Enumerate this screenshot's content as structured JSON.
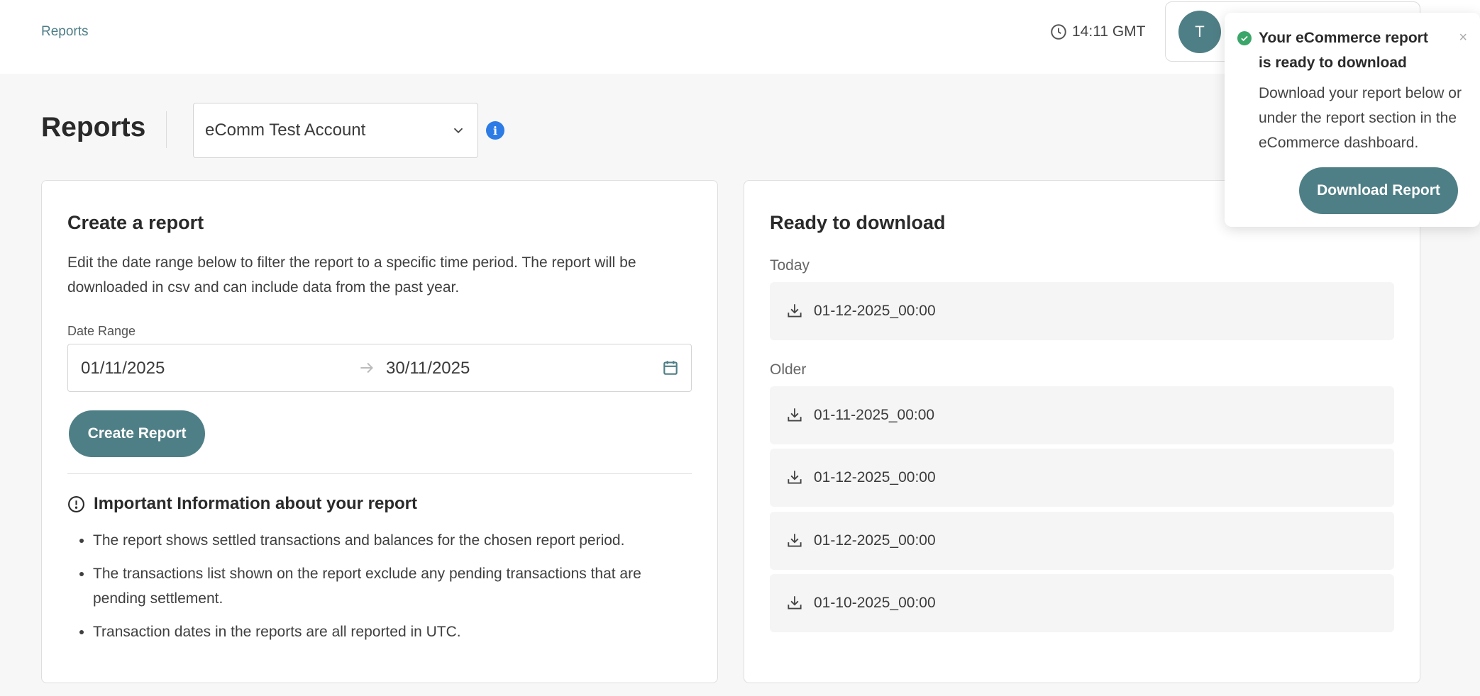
{
  "header": {
    "breadcrumb": "Reports",
    "time": "14:11 GMT",
    "avatar_initial": "T"
  },
  "page": {
    "title": "Reports",
    "account_selected": "eComm Test Account"
  },
  "create": {
    "title": "Create a report",
    "description": "Edit the date range below to filter the report to a specific time period. The report will be downloaded in csv and can include data from the past year.",
    "date_label": "Date Range",
    "date_start": "01/11/2025",
    "date_end": "30/11/2025",
    "button": "Create Report",
    "info_title": "Important Information about your report",
    "info_items": [
      "The report shows settled transactions and balances for the chosen report period.",
      "The transactions list shown on the report exclude any pending transactions that are pending settlement.",
      "Transaction dates in the reports are all reported in UTC."
    ]
  },
  "ready": {
    "title": "Ready to download",
    "today_label": "Today",
    "today_items": [
      "01-12-2025_00:00"
    ],
    "older_label": "Older",
    "older_items": [
      "01-11-2025_00:00",
      "01-12-2025_00:00",
      "01-12-2025_00:00",
      "01-10-2025_00:00"
    ]
  },
  "toast": {
    "title": "Your eCommerce report is ready to download",
    "body": "Download your report below or under the report section in the eCommerce dashboard.",
    "button": "Download Report",
    "close": "×"
  },
  "colors": {
    "accent": "#4f7f86",
    "info_blue": "#2d7be5",
    "success_green": "#3aa66a"
  }
}
